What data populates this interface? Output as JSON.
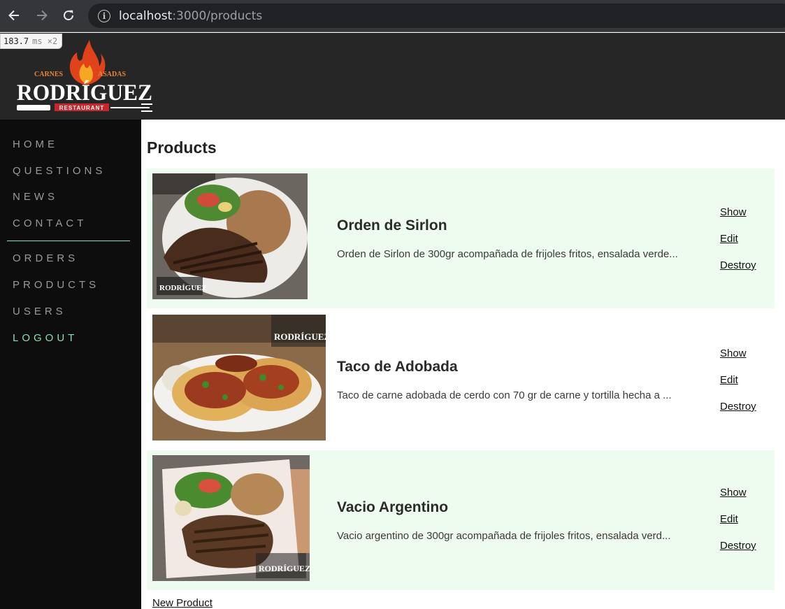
{
  "browser": {
    "url_host": "localhost",
    "url_path": ":3000/products"
  },
  "timing": {
    "value": "183.7",
    "unit": "ms ×2"
  },
  "logo": {
    "line1_left": "CARNES",
    "line1_right": "ASADAS",
    "name": "RODRÍGUEZ",
    "sub": "RESTAURANT"
  },
  "sidebar": {
    "items": [
      {
        "label": "HOME"
      },
      {
        "label": "QUESTIONS"
      },
      {
        "label": "NEWS"
      },
      {
        "label": "CONTACT"
      },
      {
        "label": "ORDERS"
      },
      {
        "label": "PRODUCTS"
      },
      {
        "label": "USERS"
      },
      {
        "label": "LOGOUT"
      }
    ]
  },
  "page": {
    "title": "Products",
    "new_product_label": "New Product"
  },
  "actions": {
    "show": "Show",
    "edit": "Edit",
    "destroy": "Destroy"
  },
  "products": [
    {
      "name": "Orden de Sirlon",
      "description": "Orden de Sirlon de 300gr acompañada de frijoles fritos, ensalada verde..."
    },
    {
      "name": "Taco de Adobada",
      "description": "Taco de carne adobada de cerdo con 70 gr de carne y tortilla hecha a ..."
    },
    {
      "name": "Vacio Argentino",
      "description": "Vacio argentino de 300gr acompañada de frijoles fritos, ensalada verd..."
    }
  ],
  "colors": {
    "accent": "#8bdfb1",
    "row_tint": "#edfcef",
    "sidebar_bg": "#0d0d0d",
    "header_bg": "#262626"
  }
}
